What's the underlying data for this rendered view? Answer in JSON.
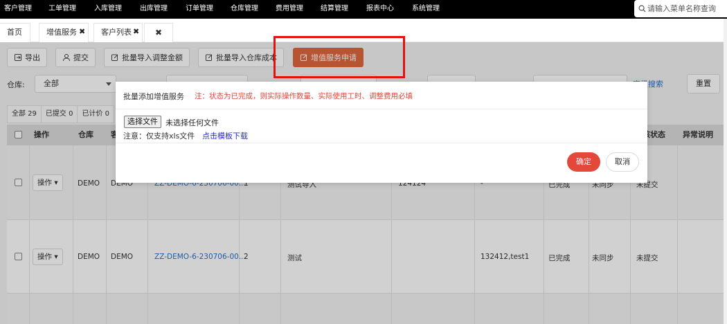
{
  "nav": {
    "items": [
      "客户管理",
      "工单管理",
      "入库管理",
      "出库管理",
      "订单管理",
      "仓库管理",
      "费用管理",
      "结算管理",
      "报表中心",
      "系统管理"
    ],
    "search_placeholder": "请输入菜单名称查询"
  },
  "tabs": {
    "home": "首页",
    "value_added": "增值服务",
    "customer_list": "客户列表",
    "close_glyph": "✖"
  },
  "toolbar": {
    "export": "导出",
    "submit": "提交",
    "import_adjust": "批量导入调整金额",
    "import_cost": "批量导入仓库成本",
    "apply": "增值服务申请"
  },
  "filters": {
    "warehouse_label": "仓库:",
    "warehouse_value": "全部",
    "advanced_search": "高级搜索",
    "reset": "重置"
  },
  "status_tabs": [
    "全部 29",
    "已提交 0",
    "已计价 0"
  ],
  "table": {
    "headers": {
      "op": "操作",
      "warehouse": "仓库",
      "customer_partial": "客",
      "audit_status": "核状态",
      "exception": "异常说明"
    },
    "op_button": "操作",
    "rows": [
      {
        "warehouse": "DEMO",
        "customer": "DEMO",
        "order_no": "ZZ-DEMO-6-230706-00...",
        "qty": "1",
        "desc": "测试导入",
        "extra": "124124",
        "ref": "-",
        "status": "已完成",
        "sync": "未同步",
        "submit": "未提交"
      },
      {
        "warehouse": "DEMO",
        "customer": "DEMO",
        "order_no": "ZZ-DEMO-6-230706-00...",
        "qty": "2",
        "desc": "测试",
        "extra": "",
        "ref": "132412,test1",
        "status": "已完成",
        "sync": "未同步",
        "submit": "未提交"
      }
    ]
  },
  "modal": {
    "title": "批量添加增值服务",
    "note": "注：状态为已完成，则实际操作数量、实际使用工时、调整费用必填",
    "choose_file": "选择文件",
    "no_file": "未选择任何文件",
    "hint": "注意：仅支持xls文件",
    "download_link": "点击模板下载",
    "ok": "确定",
    "cancel": "取消"
  },
  "colors": {
    "nav_bg": "#000000",
    "primary": "#e0683f",
    "highlight": "#e4120e",
    "ok_button": "#e4483a",
    "link": "#2a6fc9"
  }
}
